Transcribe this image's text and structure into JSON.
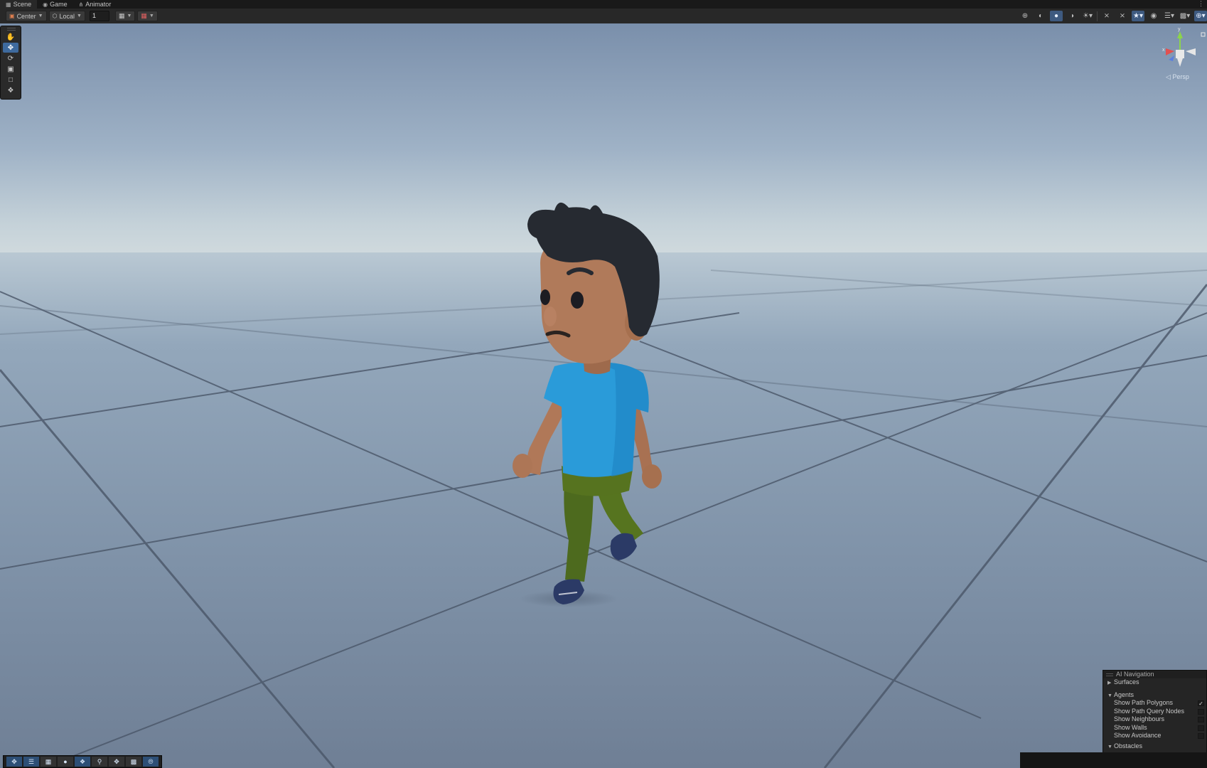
{
  "tabs": [
    {
      "label": "Scene",
      "icon": "scene-icon",
      "active": true
    },
    {
      "label": "Game",
      "icon": "gamepad-icon",
      "active": false
    },
    {
      "label": "Animator",
      "icon": "animator-icon",
      "active": false
    }
  ],
  "toolbar": {
    "pivot_label": "Center",
    "space_label": "Local",
    "grid_value": "1"
  },
  "scene": {
    "projection_label": "◁ Persp"
  },
  "ai_navigation": {
    "title": "AI Navigation",
    "surfaces": "Surfaces",
    "agents": "Agents",
    "options": [
      {
        "label": "Show Path Polygons",
        "checked": true
      },
      {
        "label": "Show Path Query Nodes",
        "checked": false
      },
      {
        "label": "Show Neighbours",
        "checked": false
      },
      {
        "label": "Show Walls",
        "checked": false
      },
      {
        "label": "Show Avoidance",
        "checked": false
      }
    ],
    "obstacles": "Obstacles"
  },
  "colors": {
    "sky_top": "#7a90ad",
    "horizon": "#c9d5dc",
    "ground": "#7d8fa6",
    "shirt": "#2a9ad8",
    "pants": "#4f6b1f",
    "skin": "#b07a5a",
    "hair": "#262a30",
    "accent": "#3e6a9e"
  }
}
